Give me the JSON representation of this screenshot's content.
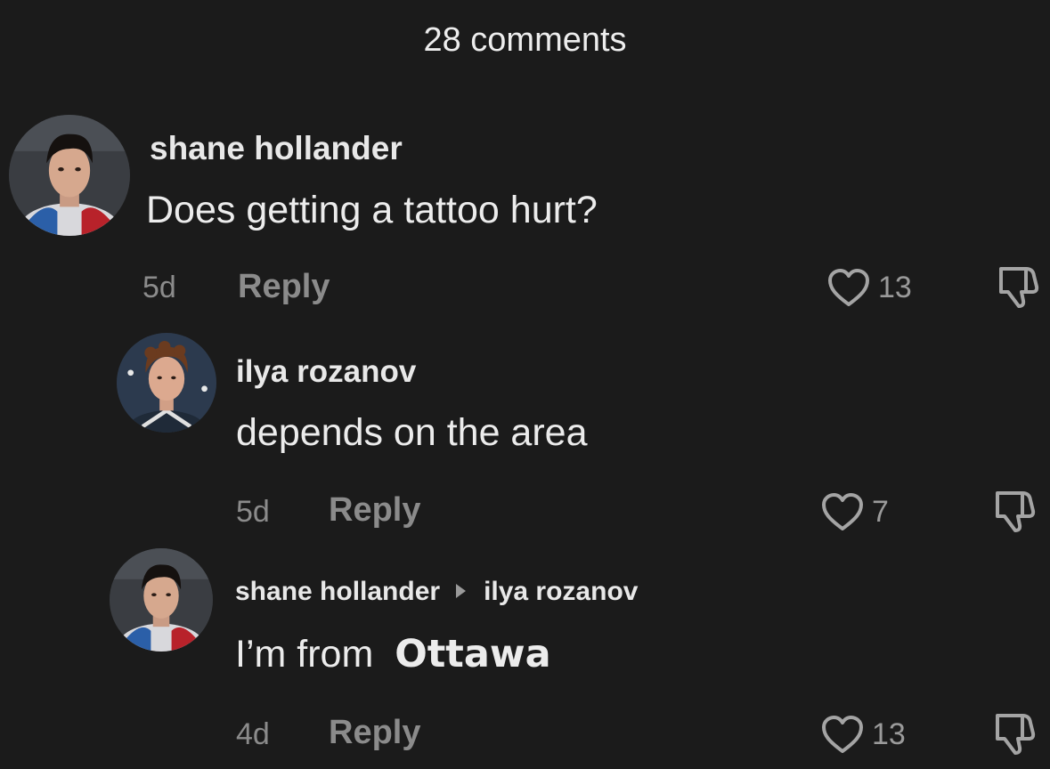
{
  "header": {
    "title": "28 comments"
  },
  "comments": [
    {
      "username": "shane hollander",
      "text": "Does getting a tattoo hurt?",
      "time": "5d",
      "reply_label": "Reply",
      "likes": "13"
    },
    {
      "username": "ilya rozanov",
      "text": "depends on the area",
      "time": "5d",
      "reply_label": "Reply",
      "likes": "7"
    },
    {
      "username": "shane hollander",
      "reply_to": "ilya rozanov",
      "text_prefix": "I’m from",
      "text_bold": "Ottawa",
      "time": "4d",
      "reply_label": "Reply",
      "likes": "13"
    }
  ],
  "icons": {
    "like": "heart-outline-icon",
    "dislike": "thumbs-down-icon",
    "reply_arrow": "right-triangle-icon"
  },
  "colors": {
    "background": "#1b1b1b",
    "text": "#ececec",
    "muted": "#8b8b8b"
  }
}
